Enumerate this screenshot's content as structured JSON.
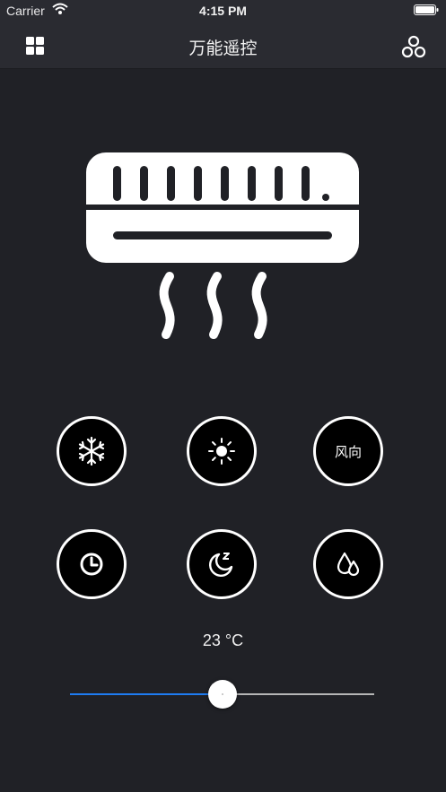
{
  "status_bar": {
    "carrier": "Carrier",
    "time": "4:15 PM",
    "icons": [
      "wifi-icon",
      "battery-icon"
    ]
  },
  "nav": {
    "title": "万能遥控",
    "left_icon": "grid-icon",
    "right_icon": "share-nodes-icon"
  },
  "hero_icon": "air-conditioner-icon",
  "mode_buttons": [
    {
      "icon": "snowflake-icon",
      "label": ""
    },
    {
      "icon": "sun-icon",
      "label": ""
    },
    {
      "icon": "",
      "label": "风向"
    },
    {
      "icon": "clock-icon",
      "label": ""
    },
    {
      "icon": "moon-sleep-icon",
      "label": ""
    },
    {
      "icon": "water-drops-icon",
      "label": ""
    }
  ],
  "temperature": {
    "label": "23 °C",
    "value": 23,
    "slider_fraction": 0.5
  },
  "colors": {
    "background": "#202126",
    "bar": "#2a2b31",
    "accent": "#1e7cf2",
    "button_fill": "#000000",
    "button_border": "#ffffff"
  }
}
